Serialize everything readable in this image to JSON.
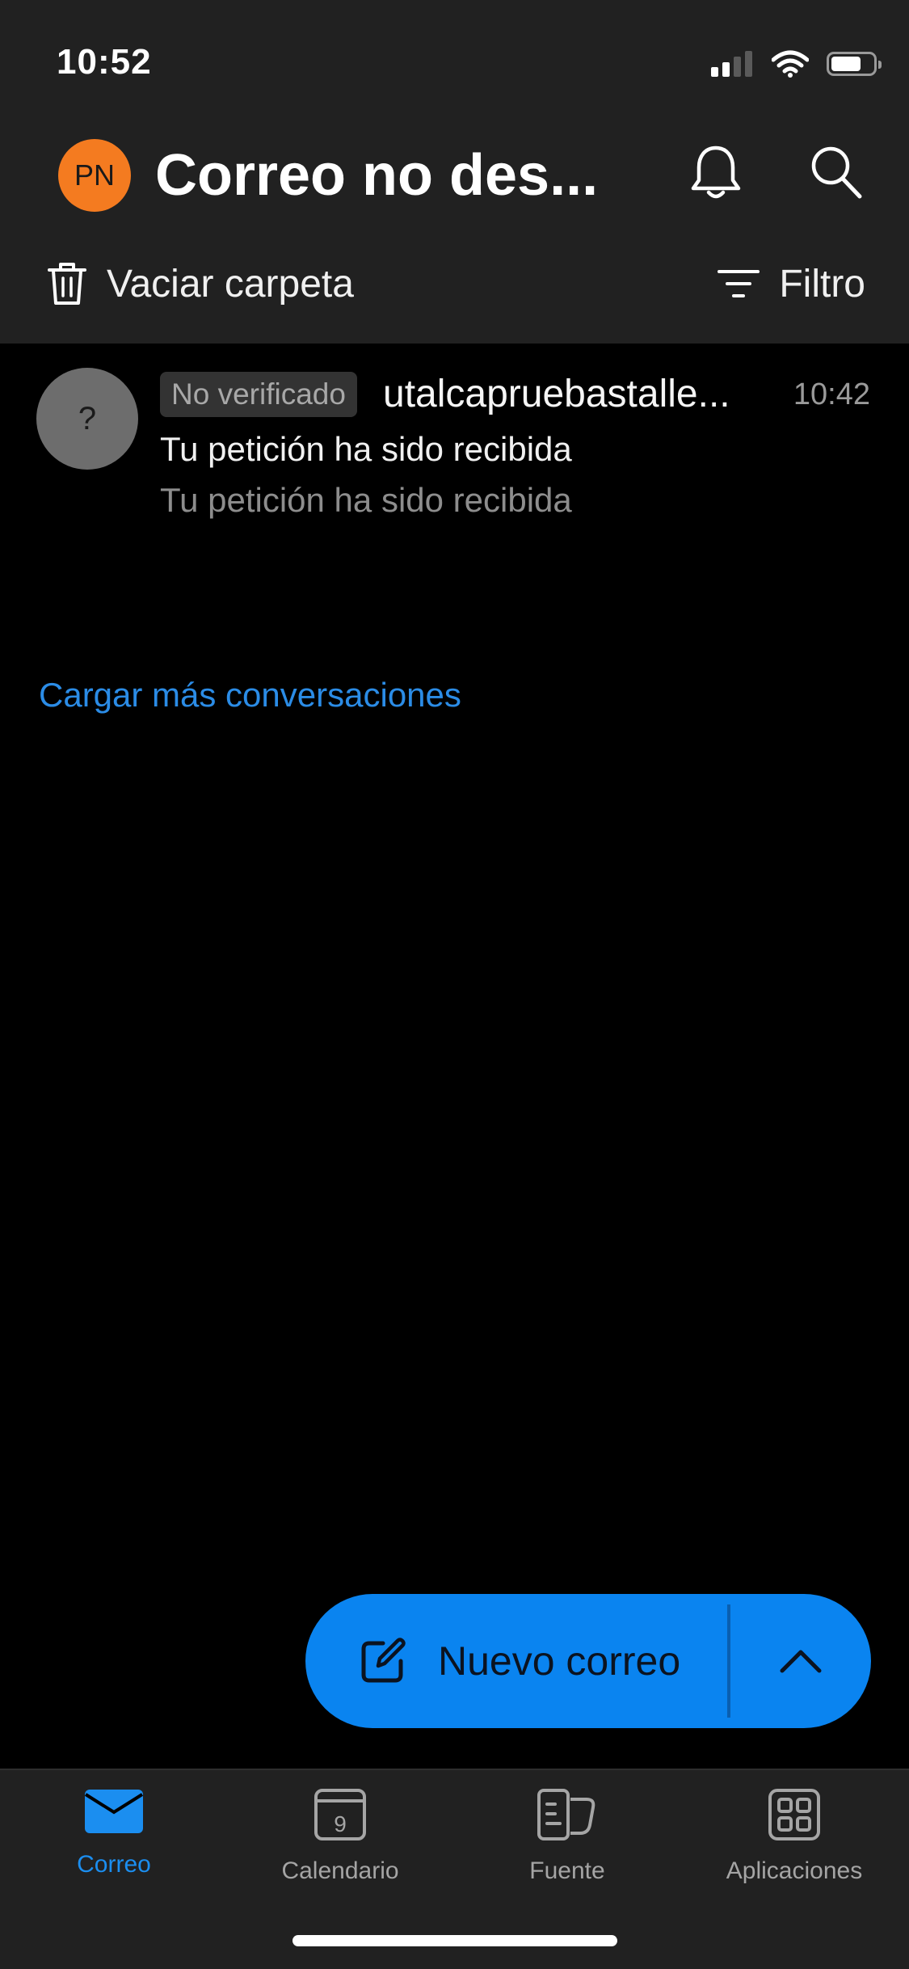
{
  "status_bar": {
    "time": "10:52",
    "icons": [
      "signal-icon",
      "wifi-icon",
      "battery-icon"
    ]
  },
  "header": {
    "avatar_initials": "PN",
    "folder_title": "Correo no des...",
    "notifications_icon": "bell-icon",
    "search_icon": "search-icon",
    "empty_folder_label": "Vaciar carpeta",
    "filter_label": "Filtro"
  },
  "messages": [
    {
      "avatar_text": "?",
      "badge": "No verificado",
      "sender": "utalcapruebastalle...",
      "time": "10:42",
      "subject": "Tu petición ha sido recibida",
      "preview": "Tu petición ha sido recibida"
    }
  ],
  "load_more_label": "Cargar más conversaciones",
  "compose": {
    "label": "Nuevo correo",
    "icon": "compose-icon",
    "expand_icon": "chevron-up-icon"
  },
  "tabs": [
    {
      "label": "Correo",
      "icon": "mail-icon",
      "active": true
    },
    {
      "label": "Calendario",
      "icon": "calendar-icon",
      "day": "9"
    },
    {
      "label": "Fuente",
      "icon": "feed-icon"
    },
    {
      "label": "Aplicaciones",
      "icon": "apps-icon"
    }
  ],
  "colors": {
    "accent": "#0a84f0",
    "link": "#2b8ce6",
    "avatar": "#f47b20",
    "header_bg": "#212121",
    "background": "#000000"
  }
}
